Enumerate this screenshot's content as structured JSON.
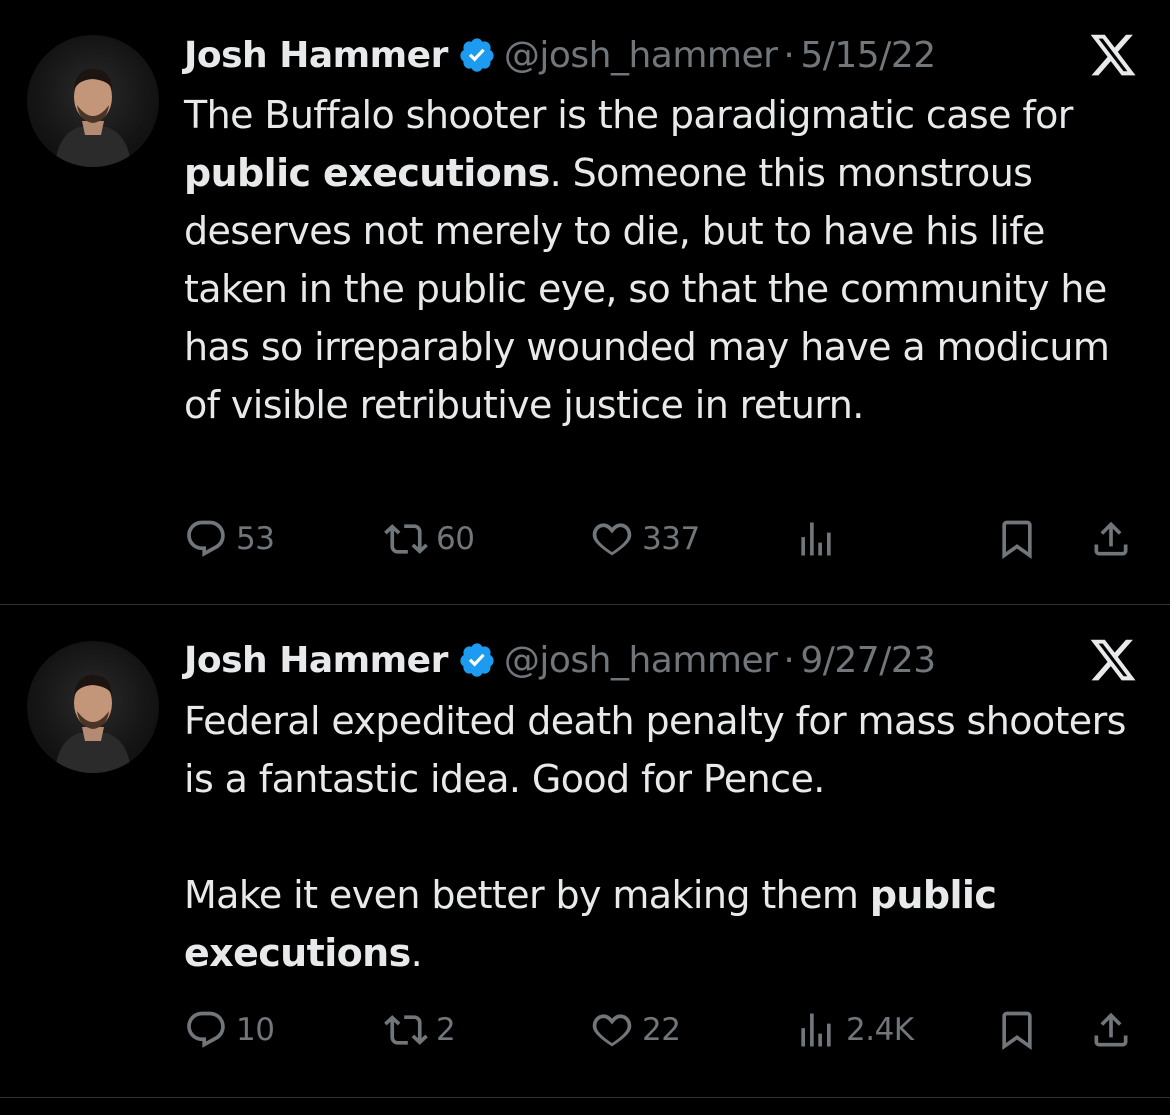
{
  "tweets": [
    {
      "author_name": "Josh Hammer",
      "verified_icon": "verified-badge-icon",
      "handle": "@josh_hammer",
      "separator": "·",
      "date": "5/15/22",
      "brand_icon": "x-logo-icon",
      "text_parts": [
        {
          "text": "The Buffalo shooter is the paradigmatic case for ",
          "bold": false
        },
        {
          "text": "public executions",
          "bold": true
        },
        {
          "text": ". Someone this monstrous deserves not merely to die, but to have his life taken in the public eye, so that the community he has so irreparably wounded may have a modicum of visible retributive justice in return.",
          "bold": false
        }
      ],
      "replies": "53",
      "reposts": "60",
      "likes": "337",
      "views": ""
    },
    {
      "author_name": "Josh Hammer",
      "verified_icon": "verified-badge-icon",
      "handle": "@josh_hammer",
      "separator": "·",
      "date": "9/27/23",
      "brand_icon": "x-logo-icon",
      "paragraph1": "Federal expedited death penalty for mass shooters is a fantastic idea. Good for Pence.",
      "paragraph2_parts": [
        {
          "text": "Make it even better by making them ",
          "bold": false
        },
        {
          "text": "public executions",
          "bold": true
        },
        {
          "text": ".",
          "bold": false
        }
      ],
      "replies": "10",
      "reposts": "2",
      "likes": "22",
      "views": "2.4K"
    }
  ],
  "colors": {
    "background": "#000000",
    "text": "#e7e9ea",
    "secondary": "#71767b",
    "verified": "#1d9bf0",
    "divider": "#2f3336"
  },
  "icons": [
    "reply-icon",
    "repost-icon",
    "like-icon",
    "views-icon",
    "bookmark-icon",
    "share-icon"
  ]
}
